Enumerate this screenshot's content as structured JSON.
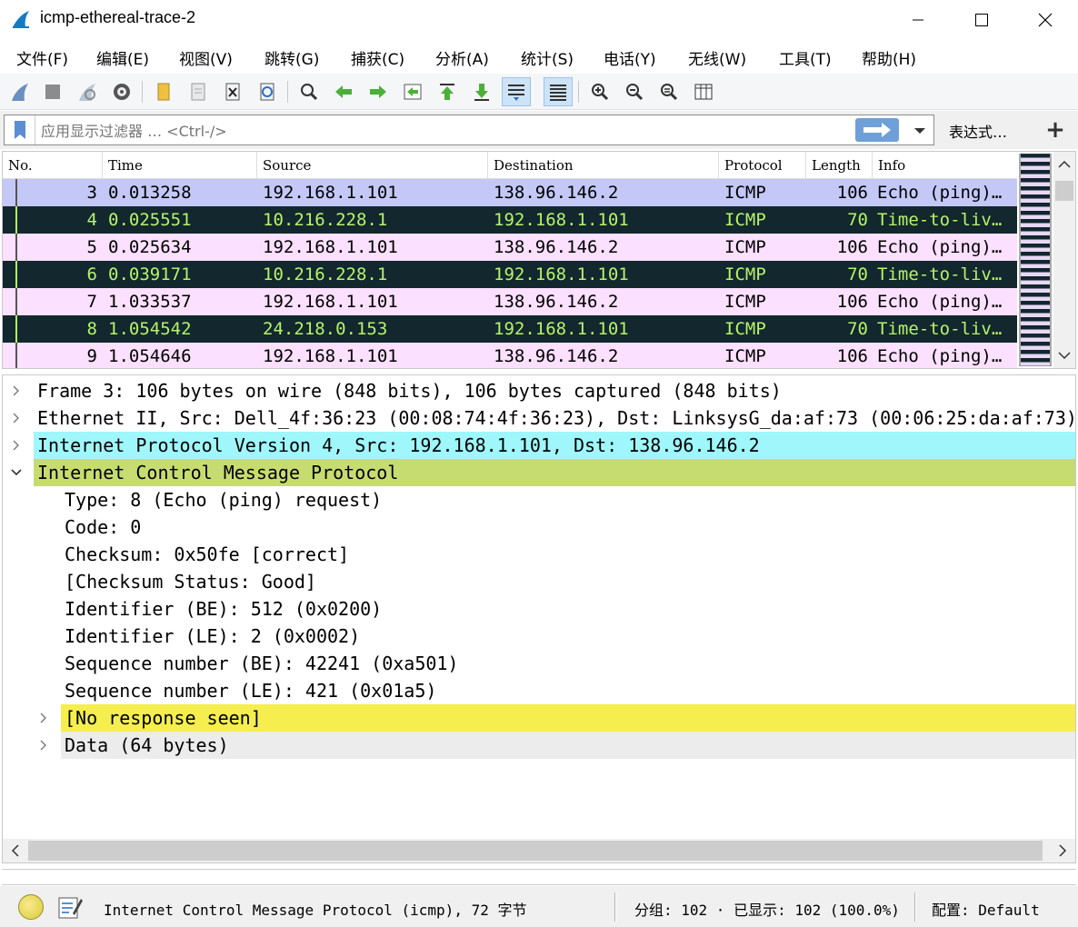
{
  "window": {
    "title": "icmp-ethereal-trace-2"
  },
  "menu": {
    "items": [
      "文件(F)",
      "编辑(E)",
      "视图(V)",
      "跳转(G)",
      "捕获(C)",
      "分析(A)",
      "统计(S)",
      "电话(Y)",
      "无线(W)",
      "工具(T)",
      "帮助(H)"
    ]
  },
  "toolbar": {
    "icons": [
      "shark-fin-start-icon",
      "stop-icon",
      "restart-icon",
      "capture-options-icon",
      "open-file-icon",
      "save-file-icon",
      "close-file-icon",
      "reload-icon",
      "find-packet-icon",
      "go-back-icon",
      "go-forward-icon",
      "go-to-packet-icon",
      "go-first-icon",
      "go-last-icon",
      "autoscroll-icon",
      "colorize-icon",
      "zoom-in-icon",
      "zoom-out-icon",
      "zoom-normal-icon",
      "resize-columns-icon"
    ]
  },
  "filter": {
    "placeholder": "应用显示过滤器 … <Ctrl-/>",
    "expression_label": "表达式…",
    "add_label": "+"
  },
  "packet_list": {
    "columns": [
      "No.",
      "Time",
      "Source",
      "Destination",
      "Protocol",
      "Length",
      "Info"
    ],
    "rows": [
      {
        "no": "3",
        "time": "0.013258",
        "src": "192.168.1.101",
        "dst": "138.96.146.2",
        "proto": "ICMP",
        "len": "106",
        "info": "Echo (ping)…",
        "style": "selected"
      },
      {
        "no": "4",
        "time": "0.025551",
        "src": "10.216.228.1",
        "dst": "192.168.1.101",
        "proto": "ICMP",
        "len": "70",
        "info": "Time-to-liv…",
        "style": "dark"
      },
      {
        "no": "5",
        "time": "0.025634",
        "src": "192.168.1.101",
        "dst": "138.96.146.2",
        "proto": "ICMP",
        "len": "106",
        "info": "Echo (ping)…",
        "style": "pink"
      },
      {
        "no": "6",
        "time": "0.039171",
        "src": "10.216.228.1",
        "dst": "192.168.1.101",
        "proto": "ICMP",
        "len": "70",
        "info": "Time-to-liv…",
        "style": "dark"
      },
      {
        "no": "7",
        "time": "1.033537",
        "src": "192.168.1.101",
        "dst": "138.96.146.2",
        "proto": "ICMP",
        "len": "106",
        "info": "Echo (ping)…",
        "style": "pink"
      },
      {
        "no": "8",
        "time": "1.054542",
        "src": "24.218.0.153",
        "dst": "192.168.1.101",
        "proto": "ICMP",
        "len": "70",
        "info": "Time-to-liv…",
        "style": "dark"
      },
      {
        "no": "9",
        "time": "1.054646",
        "src": "192.168.1.101",
        "dst": "138.96.146.2",
        "proto": "ICMP",
        "len": "106",
        "info": "Echo (ping)…",
        "style": "pink"
      }
    ]
  },
  "details": {
    "rows": [
      {
        "text": "Frame 3: 106 bytes on wire (848 bits), 106 bytes captured (848 bits)",
        "level": 0,
        "arrow": "collapsed",
        "bg": "#ffffff"
      },
      {
        "text": "Ethernet II, Src: Dell_4f:36:23 (00:08:74:4f:36:23), Dst: LinksysG_da:af:73 (00:06:25:da:af:73)",
        "level": 0,
        "arrow": "collapsed",
        "bg": "#ffffff"
      },
      {
        "text": "Internet Protocol Version 4, Src: 192.168.1.101, Dst: 138.96.146.2",
        "level": 0,
        "arrow": "collapsed",
        "bg": "#9ff7fb"
      },
      {
        "text": "Internet Control Message Protocol",
        "level": 0,
        "arrow": "expanded",
        "bg": "#c6dc70"
      },
      {
        "text": "Type: 8 (Echo (ping) request)",
        "level": 1,
        "arrow": "none",
        "bg": "#ffffff"
      },
      {
        "text": "Code: 0",
        "level": 1,
        "arrow": "none",
        "bg": "#ffffff"
      },
      {
        "text": "Checksum: 0x50fe [correct]",
        "level": 1,
        "arrow": "none",
        "bg": "#ffffff"
      },
      {
        "text": "[Checksum Status: Good]",
        "level": 1,
        "arrow": "none",
        "bg": "#ffffff"
      },
      {
        "text": "Identifier (BE): 512 (0x0200)",
        "level": 1,
        "arrow": "none",
        "bg": "#ffffff"
      },
      {
        "text": "Identifier (LE): 2 (0x0002)",
        "level": 1,
        "arrow": "none",
        "bg": "#ffffff"
      },
      {
        "text": "Sequence number (BE): 42241 (0xa501)",
        "level": 1,
        "arrow": "none",
        "bg": "#ffffff"
      },
      {
        "text": "Sequence number (LE): 421 (0x01a5)",
        "level": 1,
        "arrow": "none",
        "bg": "#ffffff"
      },
      {
        "text": "[No response seen]",
        "level": 1,
        "arrow": "collapsed",
        "bg": "#f5ee4e"
      },
      {
        "text": "Data (64 bytes)",
        "level": 1,
        "arrow": "collapsed",
        "bg": "#ececec"
      }
    ]
  },
  "status": {
    "text": "Internet Control Message Protocol (icmp), 72 字节",
    "packets": "分组: 102 · 已显示: 102 (100.0%)",
    "profile": "配置: Default"
  },
  "colors": {
    "selected_row": "#c3c8f7",
    "dark_row_bg": "#12272e",
    "dark_row_fg": "#b6f36a",
    "pink_row": "#fce0ff"
  }
}
